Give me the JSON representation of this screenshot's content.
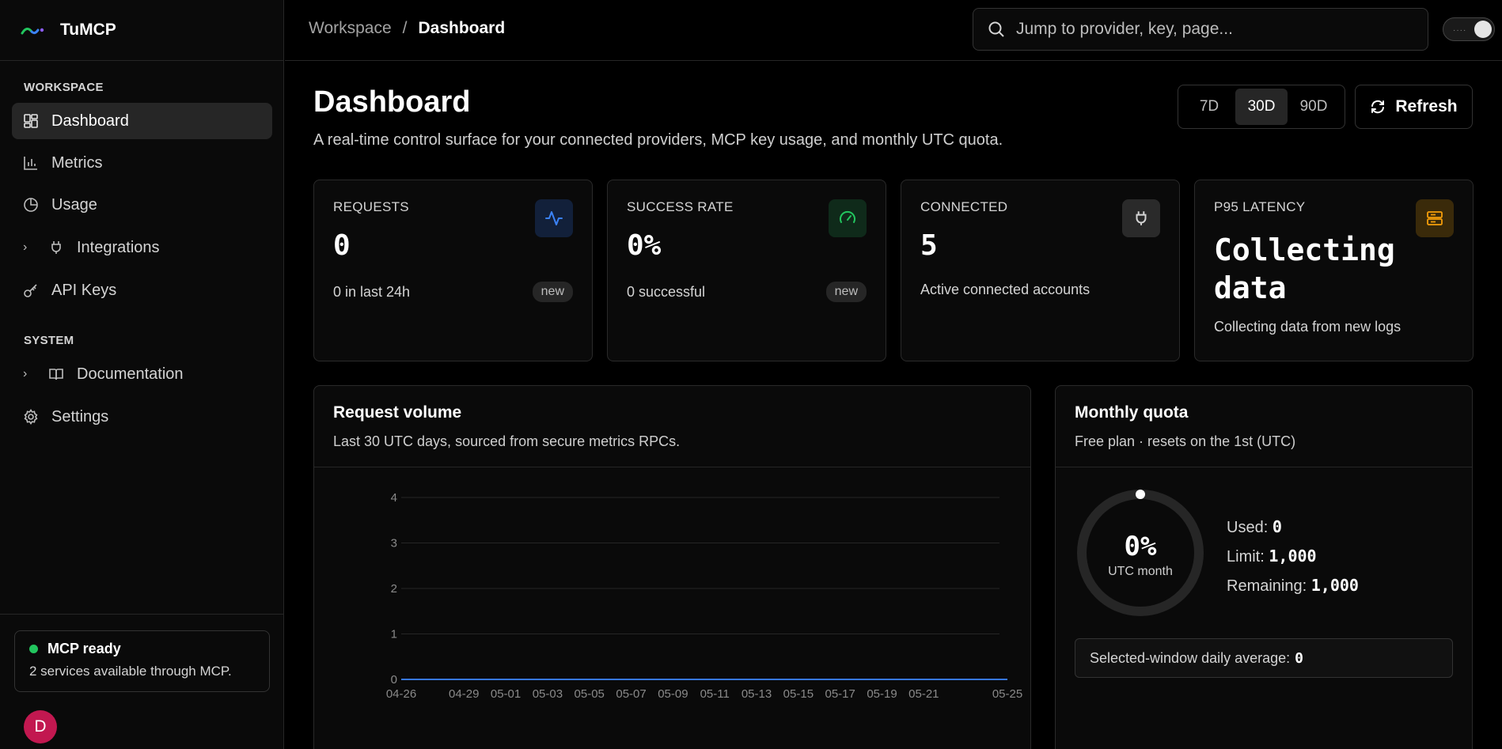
{
  "app": {
    "name": "TuMCP"
  },
  "sidebar": {
    "sections": [
      {
        "title": "WORKSPACE"
      },
      {
        "title": "SYSTEM"
      }
    ],
    "items": [
      {
        "label": "Dashboard",
        "icon": "dashboard-icon"
      },
      {
        "label": "Metrics",
        "icon": "bar-chart-icon"
      },
      {
        "label": "Usage",
        "icon": "pie-chart-icon"
      },
      {
        "label": "Integrations",
        "icon": "plug-icon"
      },
      {
        "label": "API Keys",
        "icon": "key-icon"
      },
      {
        "label": "Documentation",
        "icon": "book-icon"
      },
      {
        "label": "Settings",
        "icon": "gear-icon"
      }
    ],
    "status": {
      "title": "MCP ready",
      "description": "2 services available through MCP.",
      "color": "#22c55e"
    },
    "avatar": {
      "initial": "D",
      "color": "#c21850"
    }
  },
  "topbar": {
    "breadcrumb": {
      "parent": "Workspace",
      "separator": "/",
      "current": "Dashboard"
    },
    "search": {
      "placeholder": "Jump to provider, key, page..."
    }
  },
  "header": {
    "title": "Dashboard",
    "subtitle": "A real-time control surface for your connected providers, MCP key usage, and monthly UTC quota.",
    "ranges": [
      "7D",
      "30D",
      "90D"
    ],
    "selected_range": "30D",
    "refresh_label": "Refresh"
  },
  "stats": [
    {
      "label": "REQUESTS",
      "value": "0",
      "foot": "0 in last 24h",
      "badge": "new",
      "icon": "activity-icon",
      "accent": "#3b82f6"
    },
    {
      "label": "SUCCESS RATE",
      "value": "0%",
      "foot": "0 successful",
      "badge": "new",
      "icon": "gauge-icon",
      "accent": "#22c55e"
    },
    {
      "label": "CONNECTED",
      "value": "5",
      "foot": "Active connected accounts",
      "icon": "plug-icon",
      "accent": "#d4d4d4"
    },
    {
      "label": "P95 LATENCY",
      "value_line1": "Collecting",
      "value_line2": "data",
      "foot": "Collecting data from new logs",
      "icon": "server-icon",
      "accent": "#f59e0b"
    }
  ],
  "request_volume": {
    "title": "Request volume",
    "subtitle": "Last 30 UTC days, sourced from secure metrics RPCs."
  },
  "chart_data": {
    "type": "line",
    "x": [
      "04-26",
      "04-27",
      "04-28",
      "04-29",
      "04-30",
      "05-01",
      "05-02",
      "05-03",
      "05-04",
      "05-05",
      "05-06",
      "05-07",
      "05-08",
      "05-09",
      "05-10",
      "05-11",
      "05-12",
      "05-13",
      "05-14",
      "05-15",
      "05-16",
      "05-17",
      "05-18",
      "05-19",
      "05-20",
      "05-21",
      "05-22",
      "05-23",
      "05-24",
      "05-25"
    ],
    "x_tick_labels": [
      "04-26",
      "04-29",
      "05-01",
      "05-03",
      "05-05",
      "05-07",
      "05-09",
      "05-11",
      "05-13",
      "05-15",
      "05-17",
      "05-19",
      "05-21",
      "05-25"
    ],
    "series": [
      {
        "values": [
          0,
          0,
          0,
          0,
          0,
          0,
          0,
          0,
          0,
          0,
          0,
          0,
          0,
          0,
          0,
          0,
          0,
          0,
          0,
          0,
          0,
          0,
          0,
          0,
          0,
          0,
          0,
          0,
          0,
          0
        ]
      }
    ],
    "y_ticks": [
      0,
      1,
      2,
      3,
      4
    ],
    "ylim": [
      0,
      4
    ],
    "grid": true
  },
  "quota": {
    "title": "Monthly quota",
    "subtitle": "Free plan · resets on the 1st (UTC)",
    "percent": "0%",
    "percent_label": "UTC month",
    "used_label": "Used:",
    "used": "0",
    "limit_label": "Limit:",
    "limit": "1,000",
    "remaining_label": "Remaining:",
    "remaining": "1,000",
    "avg_label": "Selected-window daily average:",
    "avg": "0"
  }
}
